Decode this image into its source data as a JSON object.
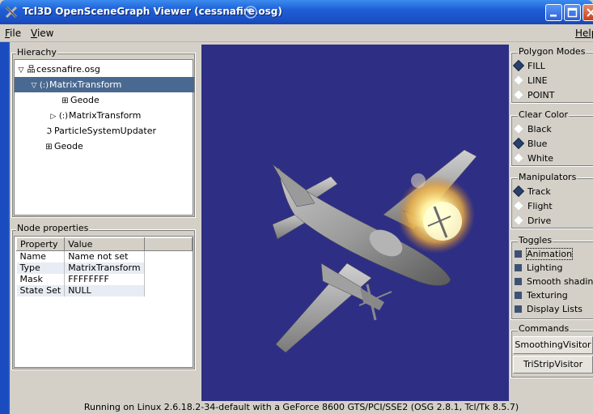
{
  "window": {
    "title": "Tcl3D OpenSceneGraph Viewer (cessnafire.osg)"
  },
  "menu": {
    "file": "File",
    "file_mn": "F",
    "file_rest": "ile",
    "view_mn": "V",
    "view_rest": "iew",
    "help": "Help"
  },
  "hierarchy": {
    "label": "Hierachy",
    "nodes": [
      {
        "label": "cessnafire.osg",
        "icon": "group-icon",
        "expanded": true
      },
      {
        "label": "MatrixTransform",
        "icon": "transform-icon",
        "expanded": true,
        "selected": true
      },
      {
        "label": "Geode",
        "icon": "geode-icon"
      },
      {
        "label": "MatrixTransform",
        "icon": "transform-icon",
        "expanded": false
      },
      {
        "label": "ParticleSystemUpdater",
        "icon": "particle-icon"
      },
      {
        "label": "Geode",
        "icon": "geode-icon"
      }
    ]
  },
  "node_properties": {
    "label": "Node properties",
    "columns": [
      "Property",
      "Value"
    ],
    "rows": [
      [
        "Name",
        "Name not set"
      ],
      [
        "Type",
        "MatrixTransform"
      ],
      [
        "Mask",
        "FFFFFFFF"
      ],
      [
        "State Set",
        "NULL"
      ]
    ]
  },
  "polygon_modes": {
    "label": "Polygon Modes",
    "options": [
      "FILL",
      "LINE",
      "POINT"
    ],
    "selected": "FILL"
  },
  "clear_color": {
    "label": "Clear Color",
    "options": [
      "Black",
      "Blue",
      "White"
    ],
    "selected": "Blue"
  },
  "manipulators": {
    "label": "Manipulators",
    "options": [
      "Track",
      "Flight",
      "Drive"
    ],
    "selected": "Track"
  },
  "toggles": {
    "label": "Toggles",
    "options": [
      "Animation",
      "Lighting",
      "Smooth shading",
      "Texturing",
      "Display Lists"
    ]
  },
  "commands": {
    "label": "Commands",
    "buttons": [
      "SmoothingVisitor",
      "TriStripVisitor"
    ]
  },
  "status": "Running on Linux 2.6.18.2-34-default with a GeForce 8600 GTS/PCI/SSE2 (OSG 2.8.1, Tcl/Tk 8.5.7)",
  "colors": {
    "viewport_bg": "#2e2f84",
    "titlebar": "#1f5fd6",
    "selection": "#4a6991"
  }
}
